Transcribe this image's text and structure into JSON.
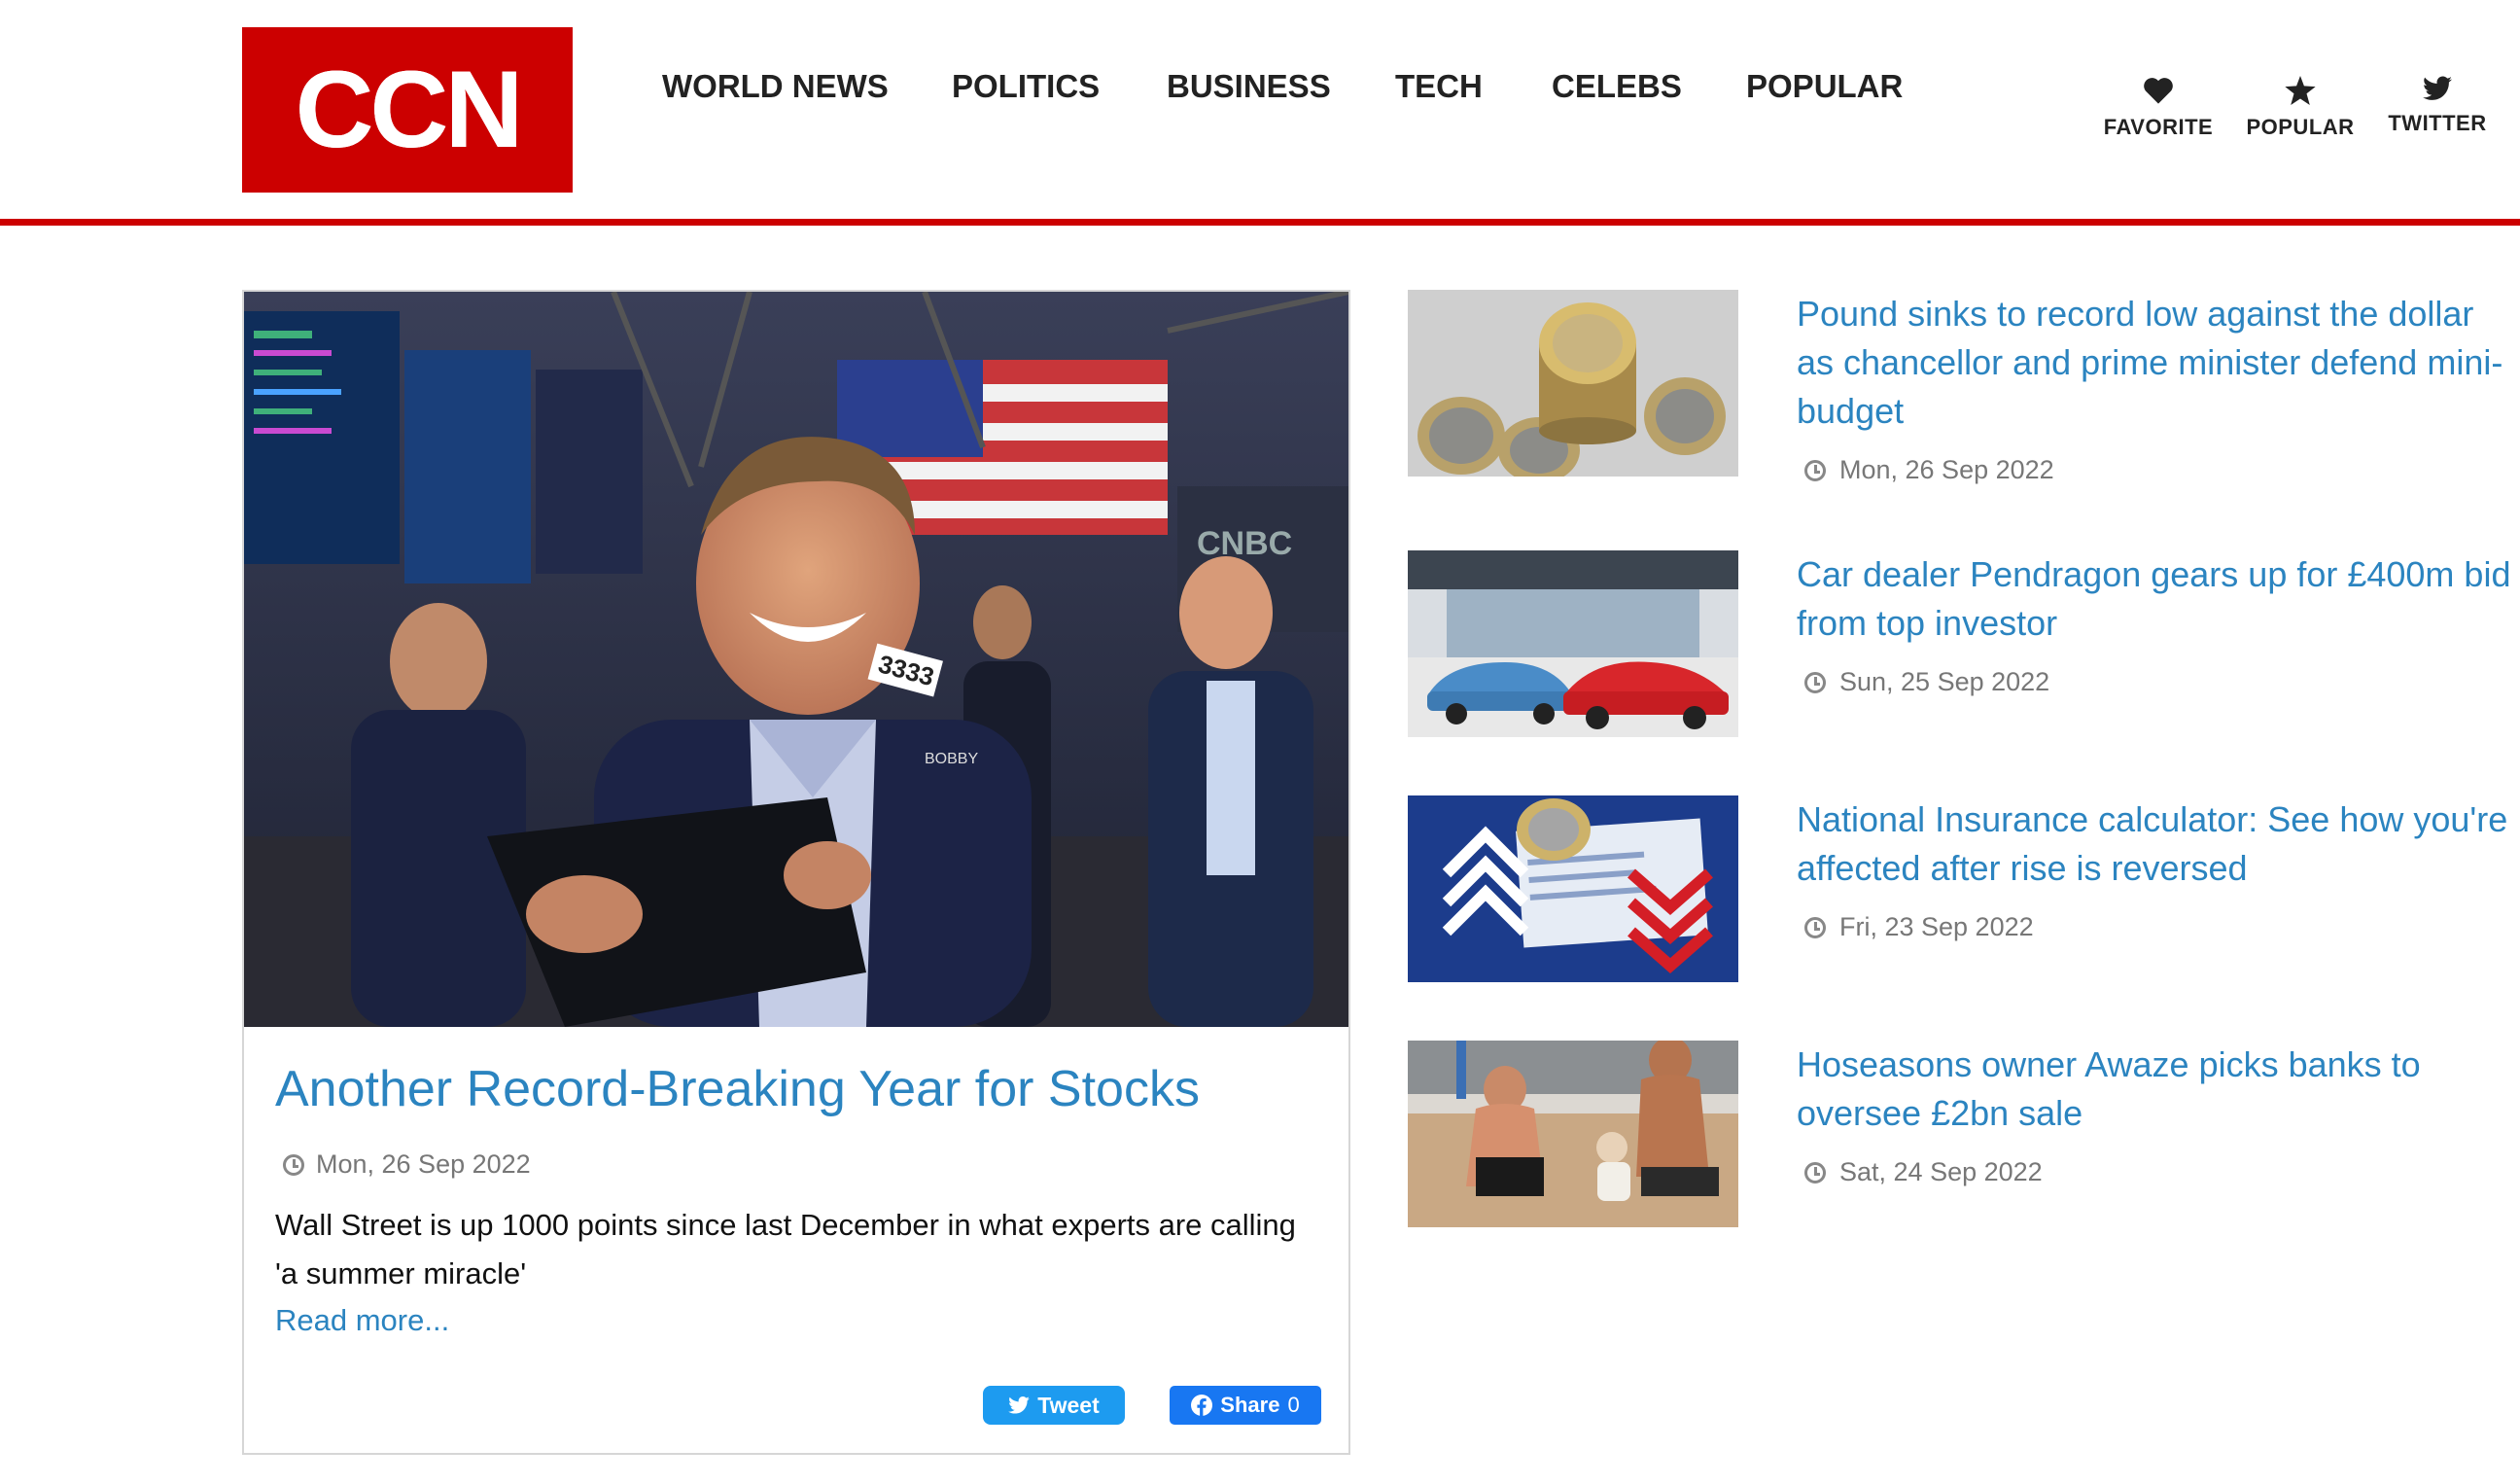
{
  "header": {
    "logo_text": "CCN",
    "nav": [
      "WORLD NEWS",
      "POLITICS",
      "BUSINESS",
      "TECH",
      "CELEBS",
      "POPULAR"
    ],
    "utility": [
      {
        "label": "FAVORITE",
        "icon": "heart-icon"
      },
      {
        "label": "POPULAR",
        "icon": "star-icon"
      },
      {
        "label": "TWITTER",
        "icon": "twitter-icon"
      }
    ]
  },
  "featured": {
    "title": "Another Record-Breaking Year for Stocks",
    "date": "Mon, 26 Sep 2022",
    "description": "Wall Street is up 1000 points since last December in what experts are calling 'a summer miracle'",
    "read_more": "Read more...",
    "tweet_label": "Tweet",
    "share_label": "Share",
    "share_count": "0",
    "image_text": {
      "badge": "3333",
      "name_tag": "BOBBY",
      "ticker_logo": "CNBC"
    }
  },
  "articles": [
    {
      "title": "Pound sinks to record low against the dollar as chancellor and prime minister defend mini-budget",
      "date": "Mon, 26 Sep 2022"
    },
    {
      "title": "Car dealer Pendragon gears up for £400m bid from top investor",
      "date": "Sun, 25 Sep 2022"
    },
    {
      "title": "National Insurance calculator: See how you're affected after rise is reversed",
      "date": "Fri, 23 Sep 2022"
    },
    {
      "title": "Hoseasons owner Awaze picks banks to oversee £2bn sale",
      "date": "Sat, 24 Sep 2022"
    }
  ],
  "colors": {
    "brand_red": "#cc0000",
    "link_blue": "#2b84c0",
    "tweet_blue": "#1d9bf0",
    "facebook_blue": "#1877f2"
  }
}
